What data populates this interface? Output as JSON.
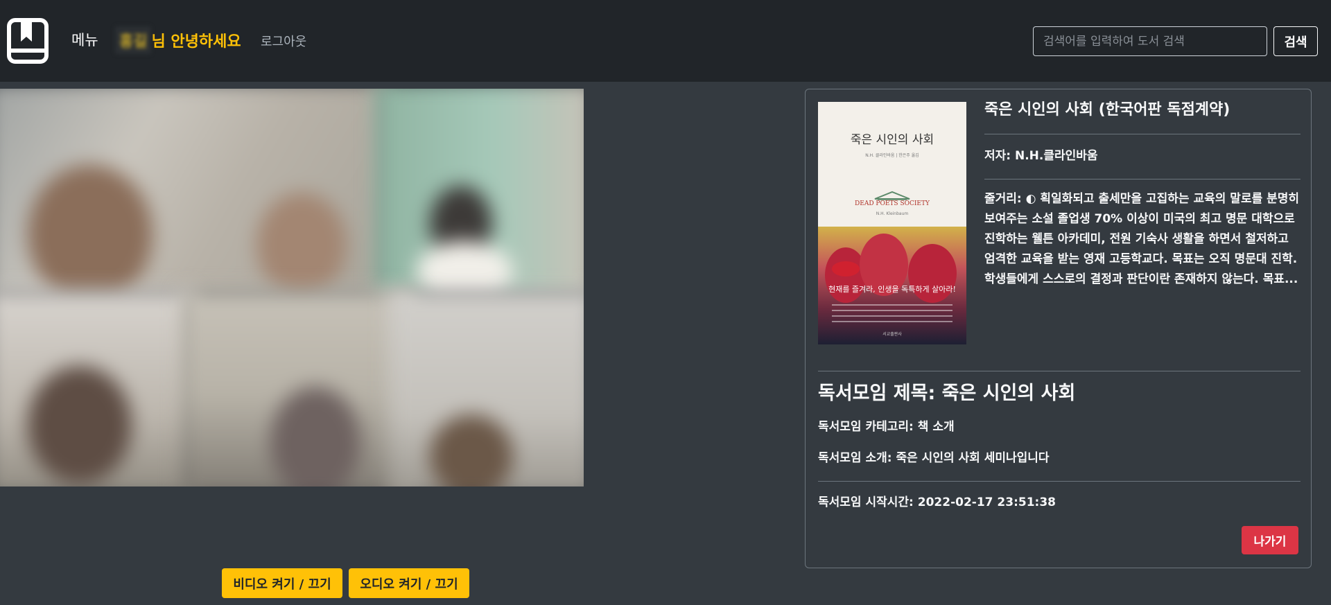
{
  "navbar": {
    "logo_icon": "book-bookmark-icon",
    "menu_label": "메뉴",
    "user_name": "홍길",
    "greeting": "님 안녕하세요",
    "logout_label": "로그아웃",
    "search_placeholder": "검색어를 입력하여 도서 검색",
    "search_value": "",
    "search_button_label": "검색"
  },
  "video": {
    "video_toggle_label": "비디오 켜기 / 끄기",
    "audio_toggle_label": "오디오 켜기 / 끄기"
  },
  "book": {
    "cover": {
      "title": "죽은 시인의 사회",
      "subtitle": "N.H. 클라인바움 | 한은주 옮김",
      "english_title": "DEAD POETS SOCIETY",
      "author_small": "N.H. Kleinbaum",
      "slogan": "현재를 즐겨라, 인생을 독특하게 살아라!",
      "publisher": "서교출판사"
    },
    "title": "죽은 시인의 사회 (한국어판 독점계약)",
    "author": "저자: N.H.클라인바움",
    "synopsis": "줄거리: ◐ 획일화되고 출세만을 고집하는 교육의 말로를 분명히 보여주는 소설 졸업생 70% 이상이 미국의 최고 명문 대학으로 진학하는 웰튼 아카데미, 전원 기숙사 생활을 하면서 철저하고 엄격한 교육을 받는 영재 고등학교다. 목표는 오직 명문대 진학. 학생들에게 스스로의 결정과 판단이란 존재하지 않는다. 목표..."
  },
  "meeting": {
    "title": "독서모임 제목: 죽은 시인의 사회",
    "category": "독서모임 카테고리: 책 소개",
    "intro": "독서모임 소개: 죽은 시인의 사회 세미나입니다",
    "start_time": "독서모임 시작시간: 2022-02-17 23:51:38",
    "leave_label": "나가기"
  },
  "colors": {
    "navbar_bg": "#212529",
    "page_bg": "#343a40",
    "accent_yellow": "#ffc107",
    "danger_red": "#dc3545"
  }
}
